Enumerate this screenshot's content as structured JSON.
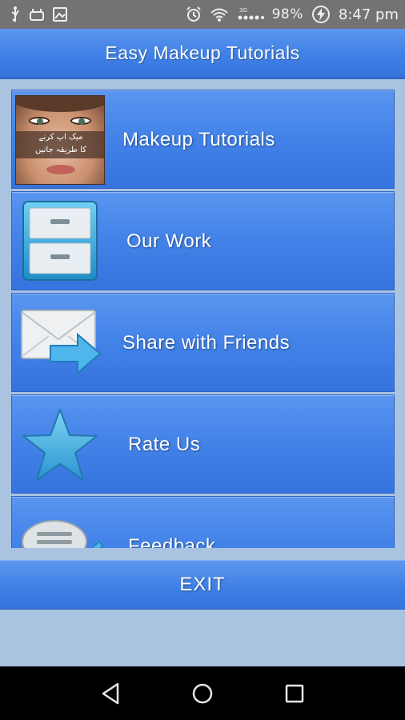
{
  "status_bar": {
    "battery_percent": "98%",
    "time": "8:47 pm",
    "network": "3G",
    "icons": [
      "usb-icon",
      "android-debug-icon",
      "image-icon",
      "alarm-icon",
      "wifi-icon",
      "signal-icon",
      "battery-charging-icon"
    ]
  },
  "header": {
    "title": "Easy Makeup Tutorials"
  },
  "menu": {
    "items": [
      {
        "label": "Makeup Tutorials",
        "icon": "makeup-face-image",
        "thumb_text_line1": "میک اپ کرنے",
        "thumb_text_line2": "کا طریقہ جانیں"
      },
      {
        "label": "Our Work",
        "icon": "filing-cabinet-icon"
      },
      {
        "label": "Share with Friends",
        "icon": "envelope-share-icon"
      },
      {
        "label": "Rate Us",
        "icon": "star-icon"
      },
      {
        "label": "Feedback",
        "icon": "speech-bubble-icon"
      }
    ]
  },
  "footer": {
    "exit_label": "EXIT"
  },
  "nav": {
    "icons": [
      "back-icon",
      "home-icon",
      "recents-icon"
    ]
  },
  "colors": {
    "accent": "#4484e9",
    "background": "#a9c3e0",
    "status_bar": "#737373"
  }
}
